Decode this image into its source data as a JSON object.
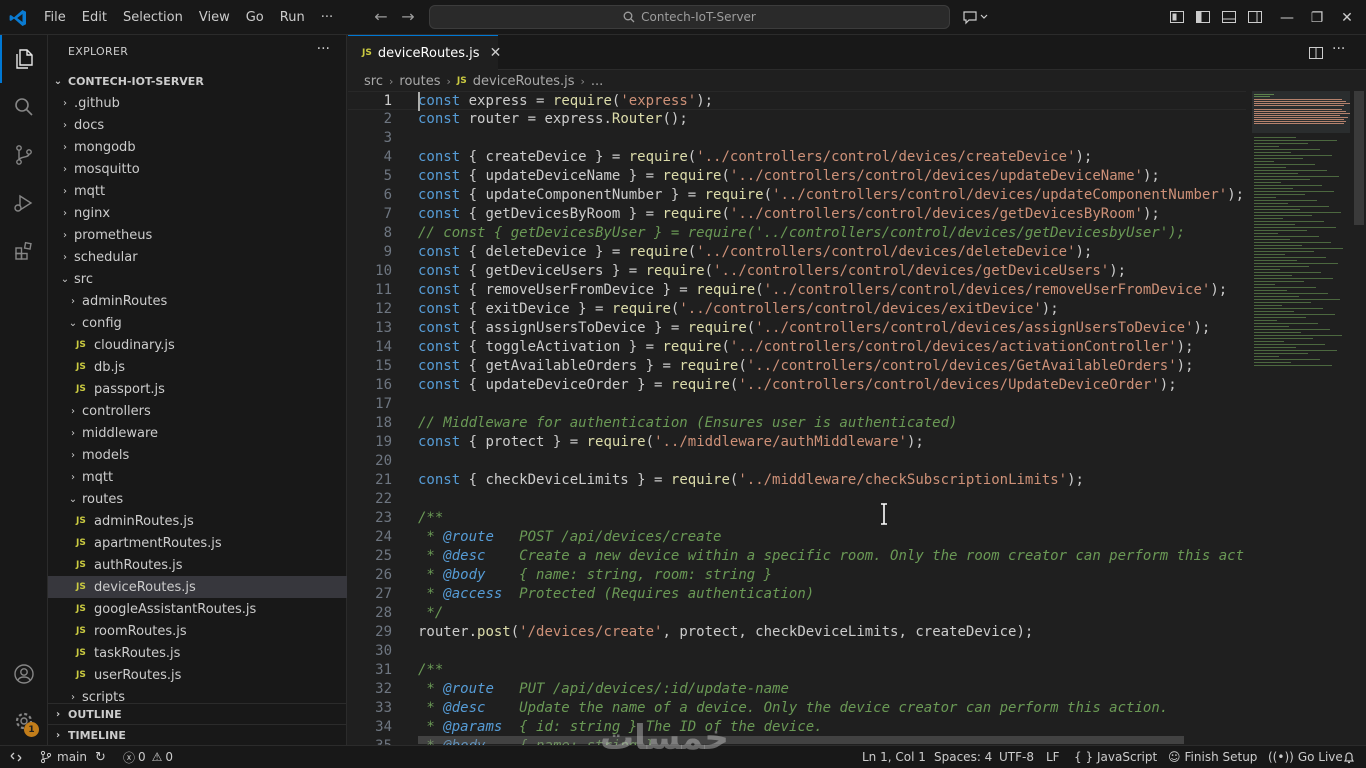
{
  "titlebar": {
    "menu": [
      "File",
      "Edit",
      "Selection",
      "View",
      "Go",
      "Run",
      "···"
    ],
    "search_text": "Contech-IoT-Server"
  },
  "sidebar": {
    "header": "EXPLORER",
    "more": "···",
    "root": "CONTECH-IOT-SERVER",
    "tree": [
      {
        "label": ".github",
        "depth": 1,
        "kind": "folder"
      },
      {
        "label": "docs",
        "depth": 1,
        "kind": "folder"
      },
      {
        "label": "mongodb",
        "depth": 1,
        "kind": "folder"
      },
      {
        "label": "mosquitto",
        "depth": 1,
        "kind": "folder"
      },
      {
        "label": "mqtt",
        "depth": 1,
        "kind": "folder"
      },
      {
        "label": "nginx",
        "depth": 1,
        "kind": "folder"
      },
      {
        "label": "prometheus",
        "depth": 1,
        "kind": "folder"
      },
      {
        "label": "schedular",
        "depth": 1,
        "kind": "folder"
      },
      {
        "label": "src",
        "depth": 1,
        "kind": "folder-open"
      },
      {
        "label": "adminRoutes",
        "depth": 2,
        "kind": "folder"
      },
      {
        "label": "config",
        "depth": 2,
        "kind": "folder-open"
      },
      {
        "label": "cloudinary.js",
        "depth": 3,
        "kind": "js"
      },
      {
        "label": "db.js",
        "depth": 3,
        "kind": "js"
      },
      {
        "label": "passport.js",
        "depth": 3,
        "kind": "js"
      },
      {
        "label": "controllers",
        "depth": 2,
        "kind": "folder"
      },
      {
        "label": "middleware",
        "depth": 2,
        "kind": "folder"
      },
      {
        "label": "models",
        "depth": 2,
        "kind": "folder"
      },
      {
        "label": "mqtt",
        "depth": 2,
        "kind": "folder"
      },
      {
        "label": "routes",
        "depth": 2,
        "kind": "folder-open"
      },
      {
        "label": "adminRoutes.js",
        "depth": 3,
        "kind": "js"
      },
      {
        "label": "apartmentRoutes.js",
        "depth": 3,
        "kind": "js"
      },
      {
        "label": "authRoutes.js",
        "depth": 3,
        "kind": "js"
      },
      {
        "label": "deviceRoutes.js",
        "depth": 3,
        "kind": "js",
        "selected": true
      },
      {
        "label": "googleAssistantRoutes.js",
        "depth": 3,
        "kind": "js"
      },
      {
        "label": "roomRoutes.js",
        "depth": 3,
        "kind": "js"
      },
      {
        "label": "taskRoutes.js",
        "depth": 3,
        "kind": "js"
      },
      {
        "label": "userRoutes.js",
        "depth": 3,
        "kind": "js"
      },
      {
        "label": "scripts",
        "depth": 2,
        "kind": "folder"
      }
    ],
    "outline": "OUTLINE",
    "timeline": "TIMELINE",
    "js_label": "JS"
  },
  "activity": {
    "badge": "1"
  },
  "editor": {
    "tab_label": "deviceRoutes.js",
    "breadcrumb": [
      "src",
      "routes",
      "deviceRoutes.js",
      "..."
    ],
    "lines": [
      [
        [
          "kw",
          "const"
        ],
        [
          "",
          "express = "
        ],
        [
          "fn",
          "require"
        ],
        [
          "",
          "("
        ],
        [
          "str",
          "'express'"
        ],
        [
          "",
          ");"
        ]
      ],
      [
        [
          "kw",
          "const"
        ],
        [
          "",
          "router = express."
        ],
        [
          "fn",
          "Router"
        ],
        [
          "",
          "();"
        ]
      ],
      [],
      [
        [
          "kw",
          "const"
        ],
        [
          "",
          "{ createDevice } = "
        ],
        [
          "fn",
          "require"
        ],
        [
          "",
          "("
        ],
        [
          "str",
          "'../controllers/control/devices/createDevice'"
        ],
        [
          "",
          ");"
        ]
      ],
      [
        [
          "kw",
          "const"
        ],
        [
          "",
          "{ updateDeviceName } = "
        ],
        [
          "fn",
          "require"
        ],
        [
          "",
          "("
        ],
        [
          "str",
          "'../controllers/control/devices/updateDeviceName'"
        ],
        [
          "",
          ");"
        ]
      ],
      [
        [
          "kw",
          "const"
        ],
        [
          "",
          "{ updateComponentNumber } = "
        ],
        [
          "fn",
          "require"
        ],
        [
          "",
          "("
        ],
        [
          "str",
          "'../controllers/control/devices/updateComponentNumber'"
        ],
        [
          "",
          ");"
        ]
      ],
      [
        [
          "kw",
          "const"
        ],
        [
          "",
          "{ getDevicesByRoom } = "
        ],
        [
          "fn",
          "require"
        ],
        [
          "",
          "("
        ],
        [
          "str",
          "'../controllers/control/devices/getDevicesByRoom'"
        ],
        [
          "",
          ");"
        ]
      ],
      [
        [
          "cm",
          "// const { getDevicesByUser } = require('../controllers/control/devices/getDevicesbyUser');"
        ]
      ],
      [
        [
          "kw",
          "const"
        ],
        [
          "",
          "{ deleteDevice } = "
        ],
        [
          "fn",
          "require"
        ],
        [
          "",
          "("
        ],
        [
          "str",
          "'../controllers/control/devices/deleteDevice'"
        ],
        [
          "",
          ");"
        ]
      ],
      [
        [
          "kw",
          "const"
        ],
        [
          "",
          "{ getDeviceUsers } = "
        ],
        [
          "fn",
          "require"
        ],
        [
          "",
          "("
        ],
        [
          "str",
          "'../controllers/control/devices/getDeviceUsers'"
        ],
        [
          "",
          ");"
        ]
      ],
      [
        [
          "kw",
          "const"
        ],
        [
          "",
          "{ removeUserFromDevice } = "
        ],
        [
          "fn",
          "require"
        ],
        [
          "",
          "("
        ],
        [
          "str",
          "'../controllers/control/devices/removeUserFromDevice'"
        ],
        [
          "",
          ");"
        ]
      ],
      [
        [
          "kw",
          "const"
        ],
        [
          "",
          "{ exitDevice } = "
        ],
        [
          "fn",
          "require"
        ],
        [
          "",
          "("
        ],
        [
          "str",
          "'../controllers/control/devices/exitDevice'"
        ],
        [
          "",
          ");"
        ]
      ],
      [
        [
          "kw",
          "const"
        ],
        [
          "",
          "{ assignUsersToDevice } = "
        ],
        [
          "fn",
          "require"
        ],
        [
          "",
          "("
        ],
        [
          "str",
          "'../controllers/control/devices/assignUsersToDevice'"
        ],
        [
          "",
          ");"
        ]
      ],
      [
        [
          "kw",
          "const"
        ],
        [
          "",
          "{ toggleActivation } = "
        ],
        [
          "fn",
          "require"
        ],
        [
          "",
          "("
        ],
        [
          "str",
          "'../controllers/control/devices/activationController'"
        ],
        [
          "",
          ");"
        ]
      ],
      [
        [
          "kw",
          "const"
        ],
        [
          "",
          "{ getAvailableOrders } = "
        ],
        [
          "fn",
          "require"
        ],
        [
          "",
          "("
        ],
        [
          "str",
          "'../controllers/control/devices/GetAvailableOrders'"
        ],
        [
          "",
          ");"
        ]
      ],
      [
        [
          "kw",
          "const"
        ],
        [
          "",
          "{ updateDeviceOrder } = "
        ],
        [
          "fn",
          "require"
        ],
        [
          "",
          "("
        ],
        [
          "str",
          "'../controllers/control/devices/UpdateDeviceOrder'"
        ],
        [
          "",
          ");"
        ]
      ],
      [],
      [
        [
          "cm",
          "// Middleware for authentication (Ensures user is authenticated)"
        ]
      ],
      [
        [
          "kw",
          "const"
        ],
        [
          "",
          "{ protect } = "
        ],
        [
          "fn",
          "require"
        ],
        [
          "",
          "("
        ],
        [
          "str",
          "'../middleware/authMiddleware'"
        ],
        [
          "",
          ");"
        ]
      ],
      [],
      [
        [
          "kw",
          "const"
        ],
        [
          "",
          "{ checkDeviceLimits } = "
        ],
        [
          "fn",
          "require"
        ],
        [
          "",
          "("
        ],
        [
          "str",
          "'../middleware/checkSubscriptionLimits'"
        ],
        [
          "",
          ");"
        ]
      ],
      [],
      [
        [
          "cm",
          "/**"
        ]
      ],
      [
        [
          "cm",
          " * "
        ],
        [
          "tag",
          "@route"
        ],
        [
          "cm",
          "   POST /api/devices/create"
        ]
      ],
      [
        [
          "cm",
          " * "
        ],
        [
          "tag",
          "@desc"
        ],
        [
          "cm",
          "    Create a new device within a specific room. Only the room creator can perform this act"
        ]
      ],
      [
        [
          "cm",
          " * "
        ],
        [
          "tag",
          "@body"
        ],
        [
          "cm",
          "    { name: string, room: string }"
        ]
      ],
      [
        [
          "cm",
          " * "
        ],
        [
          "tag",
          "@access"
        ],
        [
          "cm",
          "  Protected (Requires authentication)"
        ]
      ],
      [
        [
          "cm",
          " */"
        ]
      ],
      [
        [
          "",
          "router."
        ],
        [
          "fn",
          "post"
        ],
        [
          "",
          "("
        ],
        [
          "str",
          "'/devices/create'"
        ],
        [
          "",
          ", protect, checkDeviceLimits, createDevice);"
        ]
      ],
      [],
      [
        [
          "cm",
          "/**"
        ]
      ],
      [
        [
          "cm",
          " * "
        ],
        [
          "tag",
          "@route"
        ],
        [
          "cm",
          "   PUT /api/devices/:id/update-name"
        ]
      ],
      [
        [
          "cm",
          " * "
        ],
        [
          "tag",
          "@desc"
        ],
        [
          "cm",
          "    Update the name of a device. Only the device creator can perform this action."
        ]
      ],
      [
        [
          "cm",
          " * "
        ],
        [
          "tag",
          "@params"
        ],
        [
          "cm",
          "  { id: string } The ID of the device."
        ]
      ],
      [
        [
          "cm",
          " * "
        ],
        [
          "tag",
          "@body"
        ],
        [
          "cm",
          "    { name: string }"
        ]
      ]
    ]
  },
  "statusbar": {
    "branch": "main",
    "errors": "0",
    "warnings": "0",
    "position": "Ln 1, Col 1",
    "spaces": "Spaces: 4",
    "encoding": "UTF-8",
    "eol": "LF",
    "braces": "{ }",
    "language": "JavaScript",
    "finish_setup": "Finish Setup",
    "go_live": "Go Live"
  },
  "watermark": "خمسات",
  "colors": {
    "accent": "#0078d4",
    "keyword": "#569cd6",
    "string": "#ce9178",
    "function": "#dcdcaa",
    "comment": "#6a9955"
  }
}
